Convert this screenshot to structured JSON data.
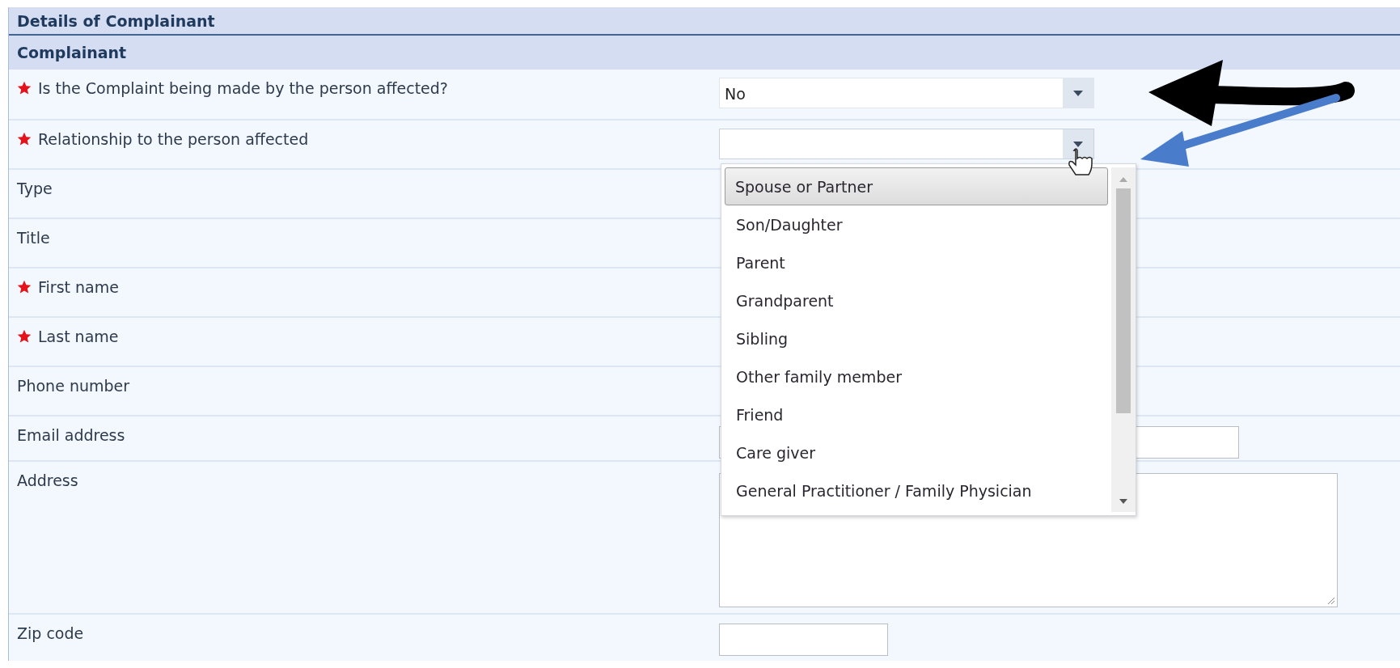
{
  "panel": {
    "title": "Details of Complainant",
    "section": "Complainant"
  },
  "rows": [
    {
      "label": "Is the Complaint being made by the person affected?",
      "required": true,
      "kind": "select",
      "value": "No"
    },
    {
      "label": "Relationship to the person affected",
      "required": true,
      "kind": "select",
      "value": "",
      "open": true
    },
    {
      "label": "Type",
      "required": false,
      "kind": "hidden"
    },
    {
      "label": "Title",
      "required": false,
      "kind": "hidden"
    },
    {
      "label": "First name",
      "required": true,
      "kind": "hidden"
    },
    {
      "label": "Last name",
      "required": true,
      "kind": "hidden"
    },
    {
      "label": "Phone number",
      "required": false,
      "kind": "hidden"
    },
    {
      "label": "Email address",
      "required": false,
      "kind": "text"
    },
    {
      "label": "Address",
      "required": false,
      "kind": "textarea"
    },
    {
      "label": "Zip code",
      "required": false,
      "kind": "short"
    }
  ],
  "dropdown": {
    "options": [
      {
        "label": "Spouse or Partner",
        "selected": true
      },
      {
        "label": "Son/Daughter",
        "selected": false
      },
      {
        "label": "Parent",
        "selected": false
      },
      {
        "label": "Grandparent",
        "selected": false
      },
      {
        "label": "Sibling",
        "selected": false
      },
      {
        "label": "Other family member",
        "selected": false
      },
      {
        "label": "Friend",
        "selected": false
      },
      {
        "label": "Care giver",
        "selected": false
      },
      {
        "label": "General Practitioner / Family Physician",
        "selected": false
      }
    ]
  }
}
